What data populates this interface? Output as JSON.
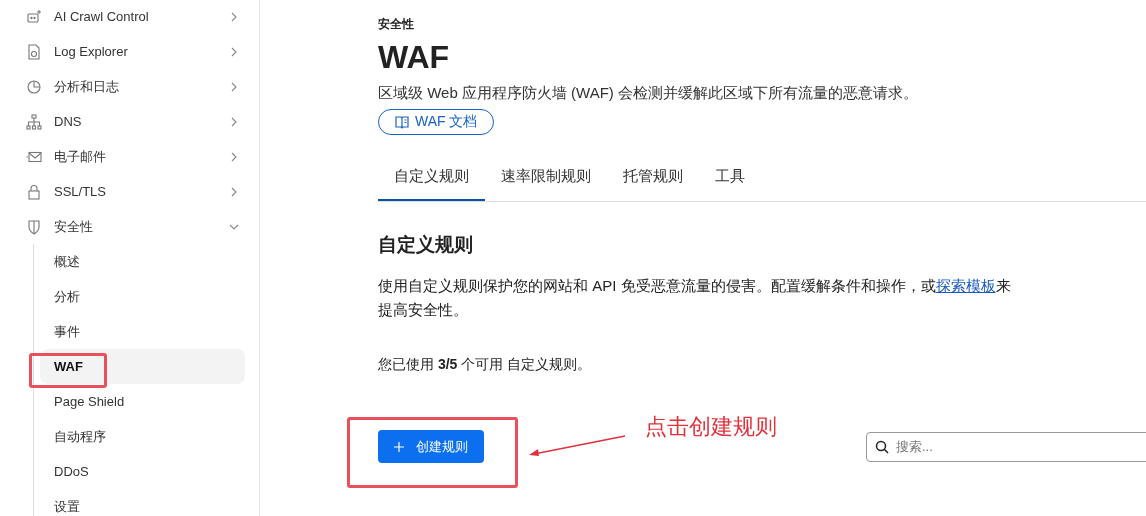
{
  "sidebar": {
    "items": [
      {
        "label": "AI Crawl Control",
        "expanded": false
      },
      {
        "label": "Log Explorer",
        "expanded": false
      },
      {
        "label": "分析和日志",
        "expanded": false
      },
      {
        "label": "DNS",
        "expanded": false
      },
      {
        "label": "电子邮件",
        "expanded": false
      },
      {
        "label": "SSL/TLS",
        "expanded": false
      },
      {
        "label": "安全性",
        "expanded": true,
        "children": [
          {
            "label": "概述",
            "selected": false
          },
          {
            "label": "分析",
            "selected": false
          },
          {
            "label": "事件",
            "selected": false
          },
          {
            "label": "WAF",
            "selected": true
          },
          {
            "label": "Page Shield",
            "selected": false
          },
          {
            "label": "自动程序",
            "selected": false
          },
          {
            "label": "DDoS",
            "selected": false
          },
          {
            "label": "设置",
            "selected": false
          }
        ]
      }
    ]
  },
  "main": {
    "breadcrumb": "安全性",
    "title": "WAF",
    "description": "区域级 Web 应用程序防火墙 (WAF) 会检测并缓解此区域下所有流量的恶意请求。",
    "docs_button": "WAF 文档",
    "tabs": [
      {
        "label": "自定义规则",
        "selected": true
      },
      {
        "label": "速率限制规则",
        "selected": false
      },
      {
        "label": "托管规则",
        "selected": false
      },
      {
        "label": "工具",
        "selected": false
      }
    ],
    "section": {
      "heading": "自定义规则",
      "paragraph": "使用自定义规则保护您的网站和 API 免受恶意流量的侵害。配置缓解条件和操作，或",
      "link": "探索模板",
      "paragraph_end": "来提高安全性。",
      "usage": "您已使用 **3/5** 个可用 自定义规则。",
      "create_button": "创建规则",
      "search": {
        "placeholder": "搜索..."
      }
    }
  },
  "annotation": {
    "text": "点击创建规则"
  }
}
